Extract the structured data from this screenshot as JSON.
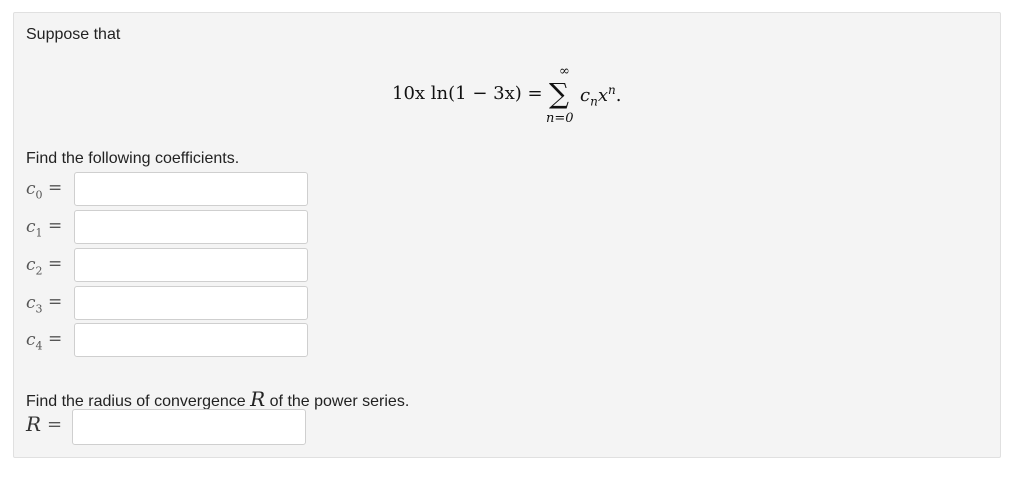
{
  "intro": "Suppose that",
  "formula": {
    "lhs": "10x ln(1 − 3x) =",
    "sigma_upper": "∞",
    "sigma_symbol": "∑",
    "sigma_lower": "n=0",
    "term_c": "c",
    "term_c_sub": "n",
    "term_x": "x",
    "term_x_sup": "n",
    "term_end": "."
  },
  "instruction": "Find the following coefficients.",
  "coefficients": [
    {
      "symbol": "c",
      "index": "0",
      "eq": "=",
      "value": ""
    },
    {
      "symbol": "c",
      "index": "1",
      "eq": "=",
      "value": ""
    },
    {
      "symbol": "c",
      "index": "2",
      "eq": "=",
      "value": ""
    },
    {
      "symbol": "c",
      "index": "3",
      "eq": "=",
      "value": ""
    },
    {
      "symbol": "c",
      "index": "4",
      "eq": "=",
      "value": ""
    }
  ],
  "radius": {
    "prompt_before": "Find the radius of convergence ",
    "symbol": "R",
    "prompt_after": " of the power series.",
    "label": "R",
    "eq": "=",
    "value": ""
  }
}
